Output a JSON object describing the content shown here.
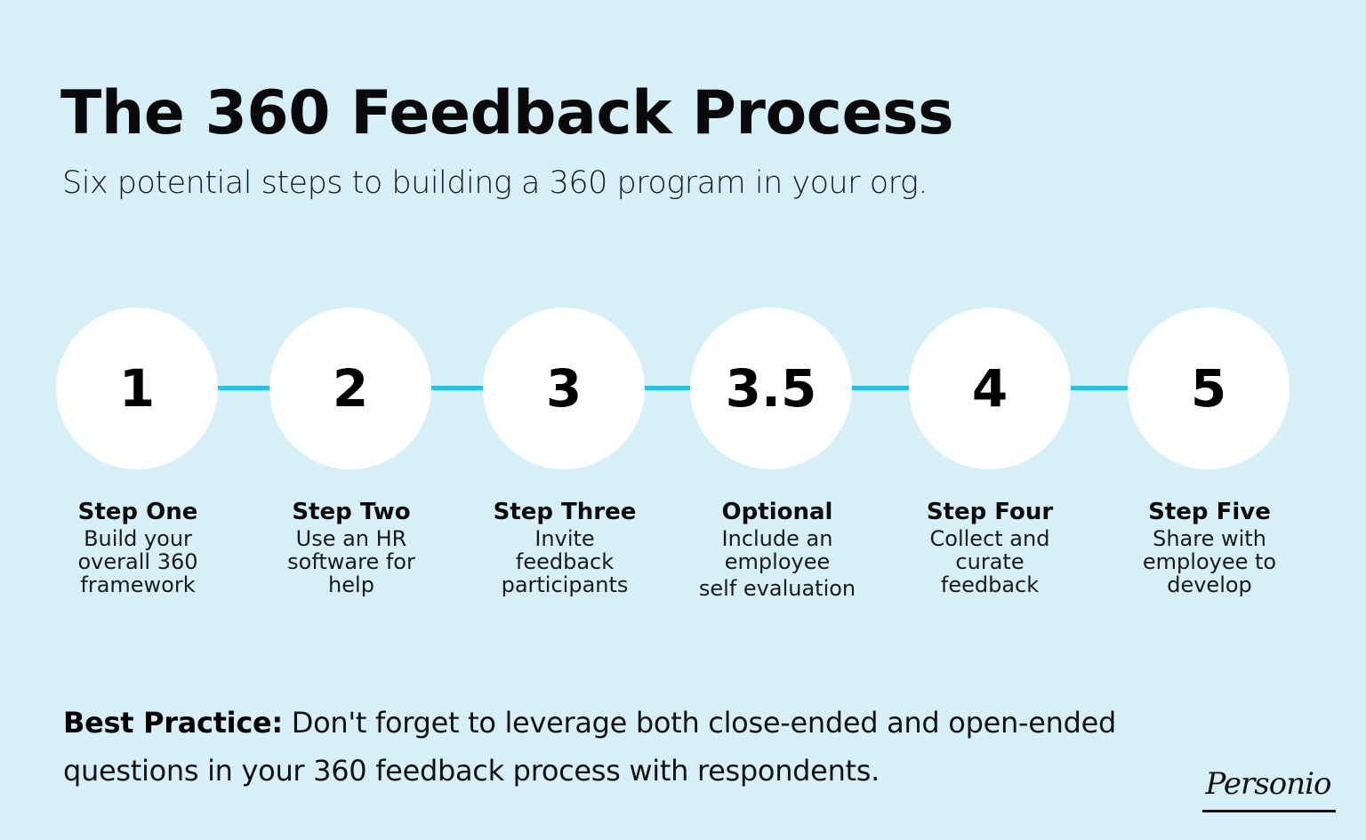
{
  "header": {
    "title": "The 360 Feedback Process",
    "subtitle": "Six potential steps to building a 360 program in your org."
  },
  "steps": [
    {
      "number": "1",
      "title": "Step One",
      "lines": [
        "Build your",
        "overall 360",
        "framework"
      ]
    },
    {
      "number": "2",
      "title": "Step Two",
      "lines": [
        "Use an HR",
        "software for",
        "help"
      ]
    },
    {
      "number": "3",
      "title": "Step Three",
      "lines": [
        "Invite",
        "feedback",
        "participants"
      ]
    },
    {
      "number": "3.5",
      "title": "Optional",
      "lines": [
        "Include an",
        "employee",
        "self evaluation"
      ]
    },
    {
      "number": "4",
      "title": "Step Four",
      "lines": [
        "Collect and",
        "curate",
        "feedback"
      ]
    },
    {
      "number": "5",
      "title": "Step Five",
      "lines": [
        "Share with",
        "employee to",
        "develop"
      ]
    }
  ],
  "best_practice": {
    "label": "Best Practice:",
    "text": "Don't forget to leverage both close-ended and open-ended questions in your 360 feedback process with respondents."
  },
  "brand": {
    "logo_text": "Personio"
  },
  "colors": {
    "background": "#d6eff8",
    "connector": "#19c6ea",
    "circle": "#ffffff"
  }
}
